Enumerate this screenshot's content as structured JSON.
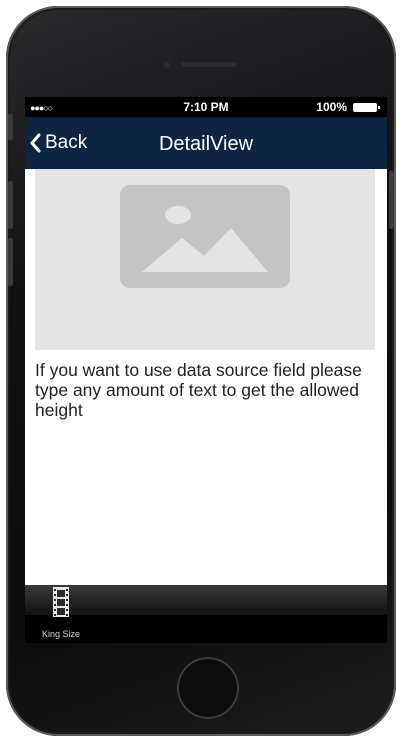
{
  "status_bar": {
    "signal": "●●●○○",
    "time": "7:10 PM",
    "battery": "100%"
  },
  "nav": {
    "back_label": "Back",
    "title": "DetailView"
  },
  "content": {
    "image_placeholder_icon": "image-placeholder-icon",
    "text": "If you want to use data source field please type any amount of text to get the allowed height"
  },
  "tab_bar": {
    "items": [
      {
        "label": "King Size",
        "icon": "film-icon"
      }
    ]
  },
  "colors": {
    "nav_background": "#0e2440",
    "image_placeholder_background": "#e4e4e4",
    "image_placeholder_icon": "#c4c4c4"
  }
}
